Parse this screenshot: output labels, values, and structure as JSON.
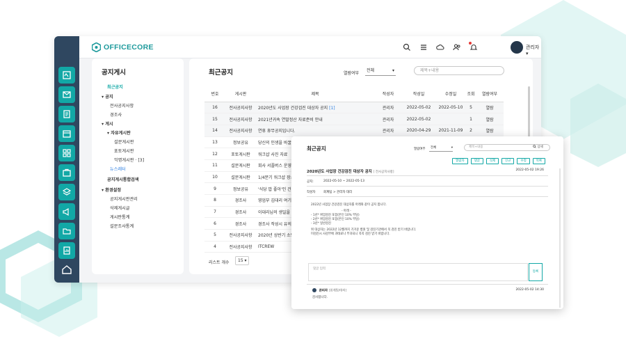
{
  "colors": {
    "accent": "#12a8a6",
    "sidebar": "#2f4760",
    "link": "#2a7de1",
    "deco_cyan": "#8ed9d6"
  },
  "app": {
    "logo": "OFFICECORE",
    "user": "관리자 ▾"
  },
  "sidebar_icons": [
    "board-icon",
    "mail-icon",
    "document-icon",
    "calendar-icon",
    "grid-icon",
    "briefcase-icon",
    "layers-icon",
    "megaphone-icon",
    "folder-icon",
    "report-icon",
    "home-icon"
  ],
  "toolbar_icons": [
    "search-icon",
    "list-icon",
    "cloud-icon",
    "users-icon",
    "bell-icon",
    "gear-icon"
  ],
  "tree": {
    "title": "공지게시",
    "items": [
      "최근공지",
      "▾  공지",
      "전사공지사항",
      "경조사",
      "▾  게시",
      "▾  자유게시판",
      "설문게시판",
      "포토게시판",
      "익명게시판 · [3]",
      "뉴스레터",
      "공지게시통합검색",
      "▾  환경설정",
      "공지게시판관리",
      "삭제게시글",
      "게시판통계",
      "설문조사통계"
    ]
  },
  "list": {
    "title": "최근공지",
    "filter_label": "열람여부",
    "filter_value": "전체",
    "search_placeholder": "제목+내용",
    "search_button": "상세",
    "columns": [
      "번호",
      "게시판",
      "제목",
      "작성자",
      "작성일",
      "수정일",
      "조회",
      "열람여부"
    ],
    "rows": [
      {
        "no": "16",
        "board": "전사공지사항",
        "title": "2020년도 사업장 건강검진 대상자 공지",
        "comments": "[1]",
        "author": "관리자",
        "created": "2022-05-02",
        "modified": "2022-05-10",
        "views": "5",
        "read": "열람"
      },
      {
        "no": "15",
        "board": "전사공지사항",
        "title": "2021년귀속 연말정산 자료준비 안내",
        "comments": "",
        "author": "관리자",
        "created": "2022-05-02",
        "modified": "",
        "views": "1",
        "read": "열람"
      },
      {
        "no": "14",
        "board": "전사공지사항",
        "title": "연휴 휴무공지입니다.",
        "comments": "",
        "author": "관리자",
        "created": "2020-04-29",
        "modified": "2021-11-09",
        "views": "2",
        "read": "열람"
      },
      {
        "no": "13",
        "board": "정보공유",
        "title": "당신의 인생을 바꿀",
        "comments": "",
        "author": "",
        "created": "",
        "modified": "",
        "views": "",
        "read": ""
      },
      {
        "no": "12",
        "board": "포토게시판",
        "title": "워크샵 사진 자료",
        "comments": "",
        "author": "",
        "created": "",
        "modified": "",
        "views": "",
        "read": ""
      },
      {
        "no": "11",
        "board": "설문게시판",
        "title": "회사 서플버스 운영",
        "comments": "",
        "author": "",
        "created": "",
        "modified": "",
        "views": "",
        "read": ""
      },
      {
        "no": "10",
        "board": "설문게시판",
        "title": "1/4분기 워크샵 장소",
        "comments": "",
        "author": "",
        "created": "",
        "modified": "",
        "views": "",
        "read": ""
      },
      {
        "no": "9",
        "board": "정보공유",
        "title": "'식당 밥 좋아'인 건",
        "comments": "",
        "author": "",
        "created": "",
        "modified": "",
        "views": "",
        "read": ""
      },
      {
        "no": "8",
        "board": "경조사",
        "title": "영업부 김대리 여기",
        "comments": "",
        "author": "",
        "created": "",
        "modified": "",
        "views": "",
        "read": ""
      },
      {
        "no": "7",
        "board": "경조사",
        "title": "이대리님의 생일을",
        "comments": "",
        "author": "",
        "created": "",
        "modified": "",
        "views": "",
        "read": ""
      },
      {
        "no": "6",
        "board": "경조사",
        "title": "경조사 작성시 유의",
        "comments": "",
        "author": "",
        "created": "",
        "modified": "",
        "views": "",
        "read": ""
      },
      {
        "no": "5",
        "board": "전사공지사항",
        "title": "2020년 상반기 소방",
        "comments": "",
        "author": "",
        "created": "",
        "modified": "",
        "views": "",
        "read": ""
      },
      {
        "no": "4",
        "board": "전사공지사항",
        "title": "ITCREW",
        "comments": "",
        "author": "",
        "created": "",
        "modified": "",
        "views": "",
        "read": ""
      }
    ],
    "footer_label": "리스트 개수",
    "footer_value": "15 ▾"
  },
  "detail": {
    "title": "최근공지",
    "filter_label": "열람여부",
    "filter_value": "전체",
    "search_placeholder": "제목+내용",
    "search_button": "상세",
    "buttons": [
      "열람자",
      "댓글",
      "삭제",
      "신규",
      "수정",
      "목록"
    ],
    "post_title": "2020년도 사업장 건강검진 대상자 공지",
    "post_category": "[ 전사공지사항]",
    "post_date": "2022-05-02 19:26",
    "period_label": "공지:",
    "period_value": "2022-05-10 ~ 2022-05-13",
    "author_label": "작성자",
    "author_value": "회계팀 > 관리자 대리",
    "body": [
      "2022년 사업장 건강검진 대상자를 아래와 같이 공지 합니다.",
      "- 아래 -",
      "- 1년*   위암검진 포함(본인 10% 부담)",
      "- 2년*   위암검진 포함(본인 10% 부담)",
      "- 3년*   일반검진",
      "위 대상자는 2022년 12월까지 기거운 병원 및 검진기관에서 꼭 검진 받기 바랍니다.",
      "미검진시 사감부에 과태료나 부과되니 꼭꼭 검진 받기 바랍니다."
    ],
    "comment_placeholder": "댓글 입력",
    "comment_button": "등록",
    "comment_user": "관리자",
    "comment_dept": "[회계팀/대리]",
    "comment_text": "감사합니다.",
    "comment_date": "2022-05-02 14:30"
  }
}
